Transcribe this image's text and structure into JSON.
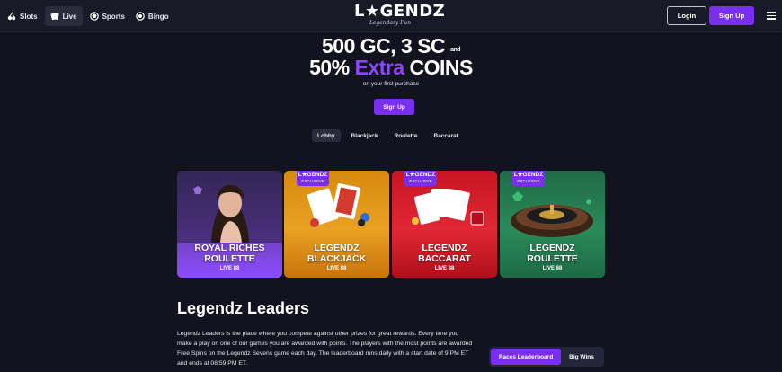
{
  "header": {
    "nav": [
      {
        "label": "Slots",
        "icon": "cherry-icon"
      },
      {
        "label": "Live",
        "icon": "cards-icon"
      },
      {
        "label": "Sports",
        "icon": "ball-icon"
      },
      {
        "label": "Bingo",
        "icon": "bingo-icon"
      }
    ],
    "logo": {
      "main": "L★GENDZ",
      "sub": "Legendary Fun"
    },
    "login_label": "Login",
    "signup_label": "Sign Up",
    "menu_icon": "hamburger-icon"
  },
  "promo": {
    "line1": "500 GC, 3 SC",
    "line1_and": "and",
    "line2_pre": "50%",
    "line2_extra": "Extra",
    "line2_post": "COINS",
    "subtitle": "on your first purchase",
    "cta": "Sign Up"
  },
  "tabs": [
    "Lobby",
    "Blackjack",
    "Roulette",
    "Baccarat"
  ],
  "active_tab": "Lobby",
  "games": [
    {
      "title_line1": "ROYAL RICHES",
      "title_line2": "ROULETTE",
      "provider": "LIVE 88",
      "badge": null
    },
    {
      "title_line1": "LEGENDZ",
      "title_line2": "BLACKJACK",
      "provider": "LIVE 88",
      "badge": {
        "name": "L★GENDZ",
        "tag": "EXCLUSIVE"
      }
    },
    {
      "title_line1": "LEGENDZ",
      "title_line2": "BACCARAT",
      "provider": "LIVE 88",
      "badge": {
        "name": "L★GENDZ",
        "tag": "EXCLUSIVE"
      }
    },
    {
      "title_line1": "LEGENDZ",
      "title_line2": "ROULETTE",
      "provider": "LIVE 88",
      "badge": {
        "name": "L★GENDZ",
        "tag": "EXCLUSIVE"
      }
    }
  ],
  "leaders": {
    "title": "Legendz Leaders",
    "description": "Legendz Leaders is the place where you compete against other prizes for great rewards. Every time you make a play on one of our games you are awarded with points. The players with the most points are awarded Free Spins on the Legendz Sevens game each day. The leaderboard runs daily with a start date of 9 PM ET and ends at 08:59 PM ET.",
    "tabs": [
      "Races Leaderboard",
      "Big Wins"
    ]
  },
  "colors": {
    "accent": "#7a2ff0",
    "background": "#12131f",
    "header": "#181a27"
  }
}
